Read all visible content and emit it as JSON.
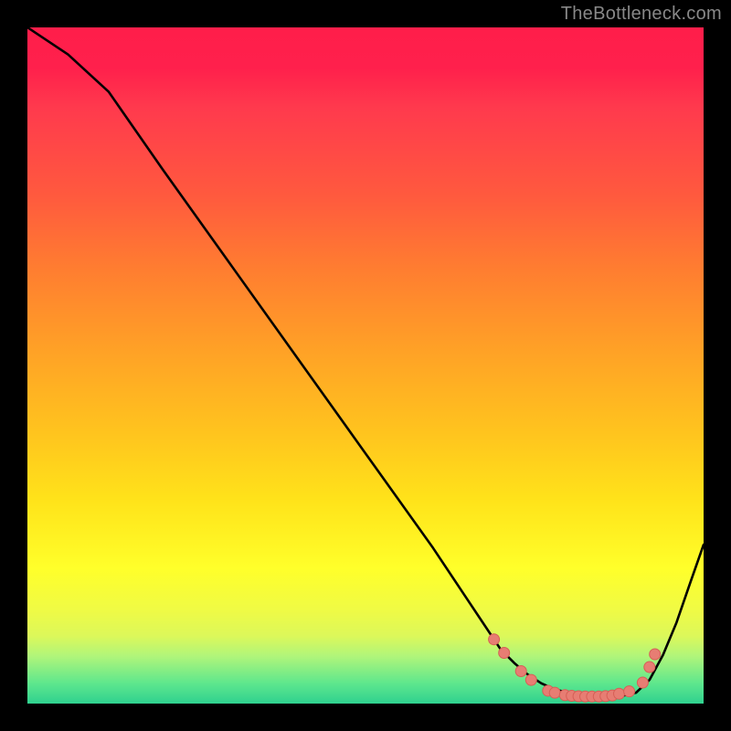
{
  "watermark": "TheBottleneck.com",
  "colors": {
    "page_bg": "#000000",
    "curve_stroke": "#000000",
    "marker_fill": "#E77D73",
    "marker_stroke": "#D65F56",
    "gradient_top": "#FF1E4A",
    "gradient_mid": "#FFE31A",
    "gradient_bottom": "#2FD18F"
  },
  "chart_data": {
    "type": "line",
    "title": "",
    "xlabel": "",
    "ylabel": "",
    "xlim": [
      0,
      100
    ],
    "ylim": [
      0,
      100
    ],
    "grid": false,
    "series": [
      {
        "name": "curve",
        "x": [
          0,
          6,
          12,
          20,
          30,
          40,
          50,
          60,
          67,
          70,
          72,
          74,
          76,
          78,
          80,
          82,
          84,
          86,
          88,
          90,
          92,
          94,
          96,
          98,
          100
        ],
        "y": [
          100,
          96,
          90.5,
          79,
          65,
          51,
          37,
          23,
          12.5,
          8,
          6,
          4.3,
          3,
          2.1,
          1.6,
          1.3,
          1.15,
          1.1,
          1.15,
          1.6,
          3.5,
          7.2,
          12,
          17.8,
          23.5
        ]
      }
    ],
    "markers": {
      "name": "salmon-dots",
      "x": [
        69,
        70.5,
        73,
        74.5,
        77,
        78,
        79.5,
        80.5,
        81.5,
        82.5,
        83.5,
        84.5,
        85.5,
        86.5,
        87.5,
        89,
        91,
        92,
        92.8
      ],
      "y": [
        9.5,
        7.5,
        4.8,
        3.5,
        1.9,
        1.6,
        1.25,
        1.15,
        1.08,
        1.05,
        1.04,
        1.05,
        1.1,
        1.2,
        1.45,
        1.8,
        3.1,
        5.4,
        7.3
      ]
    }
  }
}
